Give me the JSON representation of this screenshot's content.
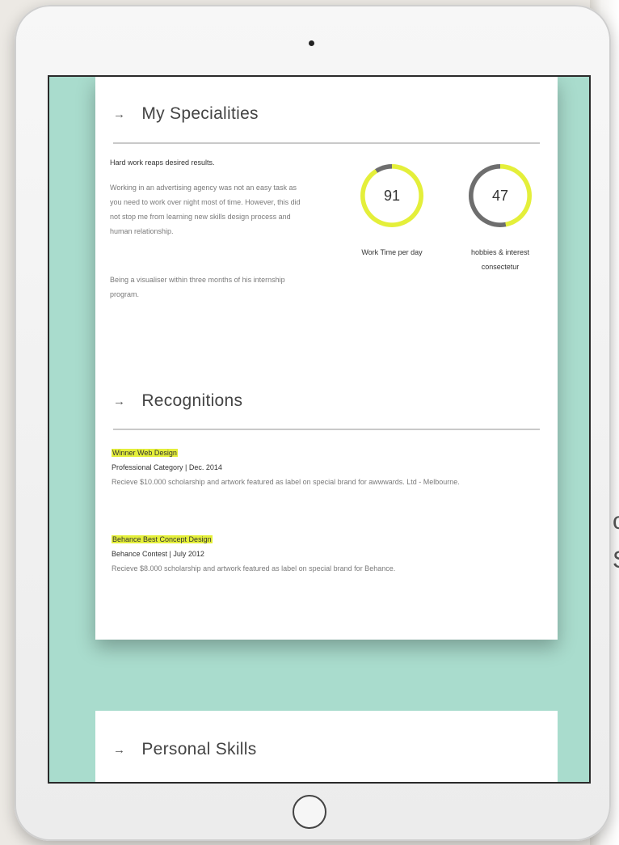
{
  "background_fragments": [
    "c",
    "S"
  ],
  "colors": {
    "accent": "#e4ef3a",
    "screen_bg": "#a9dccd",
    "ring_track": "#6e6e6e"
  },
  "specialities": {
    "heading": "My Specialities",
    "intro_heading": "Hard work reaps desired results.",
    "paragraph_1": "Working in an advertising agency was not an easy task as you need to work over night most of time. However, this did not stop me from learning new skills design process and human relationship.",
    "paragraph_2": "Being a visualiser within three months of his internship program.",
    "stats": [
      {
        "value": "91",
        "label": "Work Time per day",
        "percent": 91
      },
      {
        "value": "47",
        "label": "hobbies & interest consectetur",
        "percent": 47
      }
    ]
  },
  "recognitions": {
    "heading": "Recognitions",
    "items": [
      {
        "title": "Winner Web Design",
        "subtitle": "Professional Category | Dec. 2014",
        "description": "Recieve $10.000 scholarship and artwork featured as label on special brand for awwwards. Ltd - Melbourne."
      },
      {
        "title": "Behance Best Concept Design",
        "subtitle": "Behance Contest | July 2012",
        "description": "Recieve $8.000 scholarship and artwork featured as label on special brand for Behance."
      }
    ]
  },
  "skills": {
    "heading": "Personal Skills"
  }
}
